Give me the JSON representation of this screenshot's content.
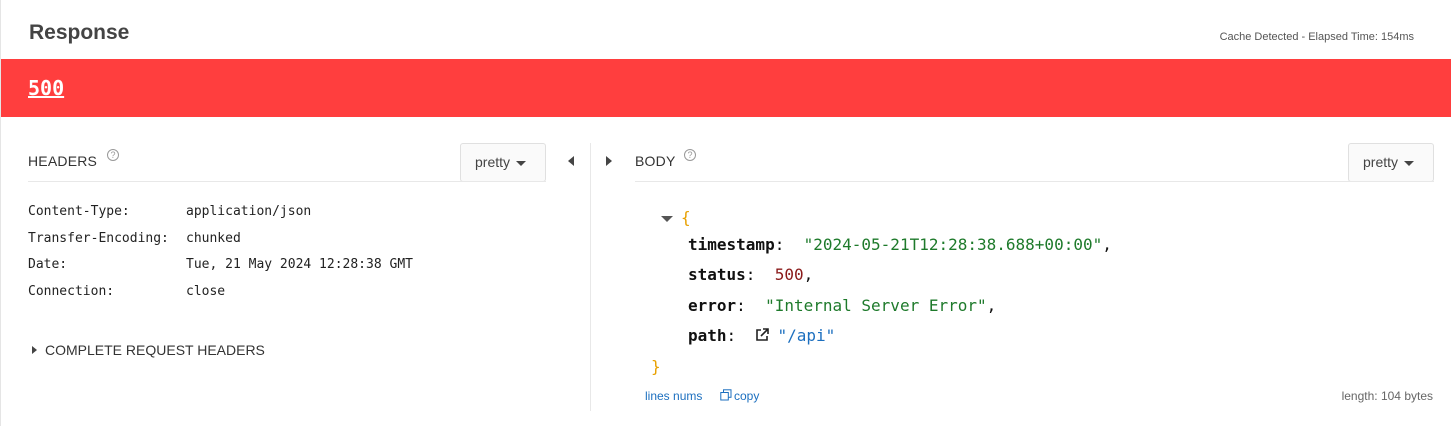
{
  "response": {
    "title": "Response",
    "meta": "Cache Detected - Elapsed Time: 154ms",
    "status_code": "500",
    "status_color": "#ff3e3e"
  },
  "headers_panel": {
    "label": "HEADERS",
    "help": "?",
    "format": "pretty",
    "rows": [
      {
        "key": "Content-Type:",
        "value": "application/json"
      },
      {
        "key": "Transfer-Encoding:",
        "value": "chunked"
      },
      {
        "key": "Date:",
        "value": "Tue, 21 May 2024 12:28:38 GMT"
      },
      {
        "key": "Connection:",
        "value": "close"
      }
    ],
    "complete_request_headers": "COMPLETE REQUEST HEADERS"
  },
  "body_panel": {
    "label": "BODY",
    "help": "?",
    "format": "pretty",
    "json": {
      "open_brace": "{",
      "close_brace": "}",
      "fields": [
        {
          "key": "timestamp",
          "value": "\"2024-05-21T12:28:38.688+00:00\"",
          "type": "string"
        },
        {
          "key": "status",
          "value": "500",
          "type": "number"
        },
        {
          "key": "error",
          "value": "\"Internal Server Error\"",
          "type": "string"
        },
        {
          "key": "path",
          "value": "\"/api\"",
          "type": "link"
        }
      ]
    },
    "line_nums": "lines nums",
    "copy": "copy",
    "length": "length: 104 bytes"
  },
  "icons": [
    "help-icon",
    "caret-down-icon",
    "collapse-left-icon",
    "expand-right-icon",
    "expand-triangle-icon",
    "collapse-triangle-icon",
    "external-link-icon",
    "copy-icon"
  ]
}
